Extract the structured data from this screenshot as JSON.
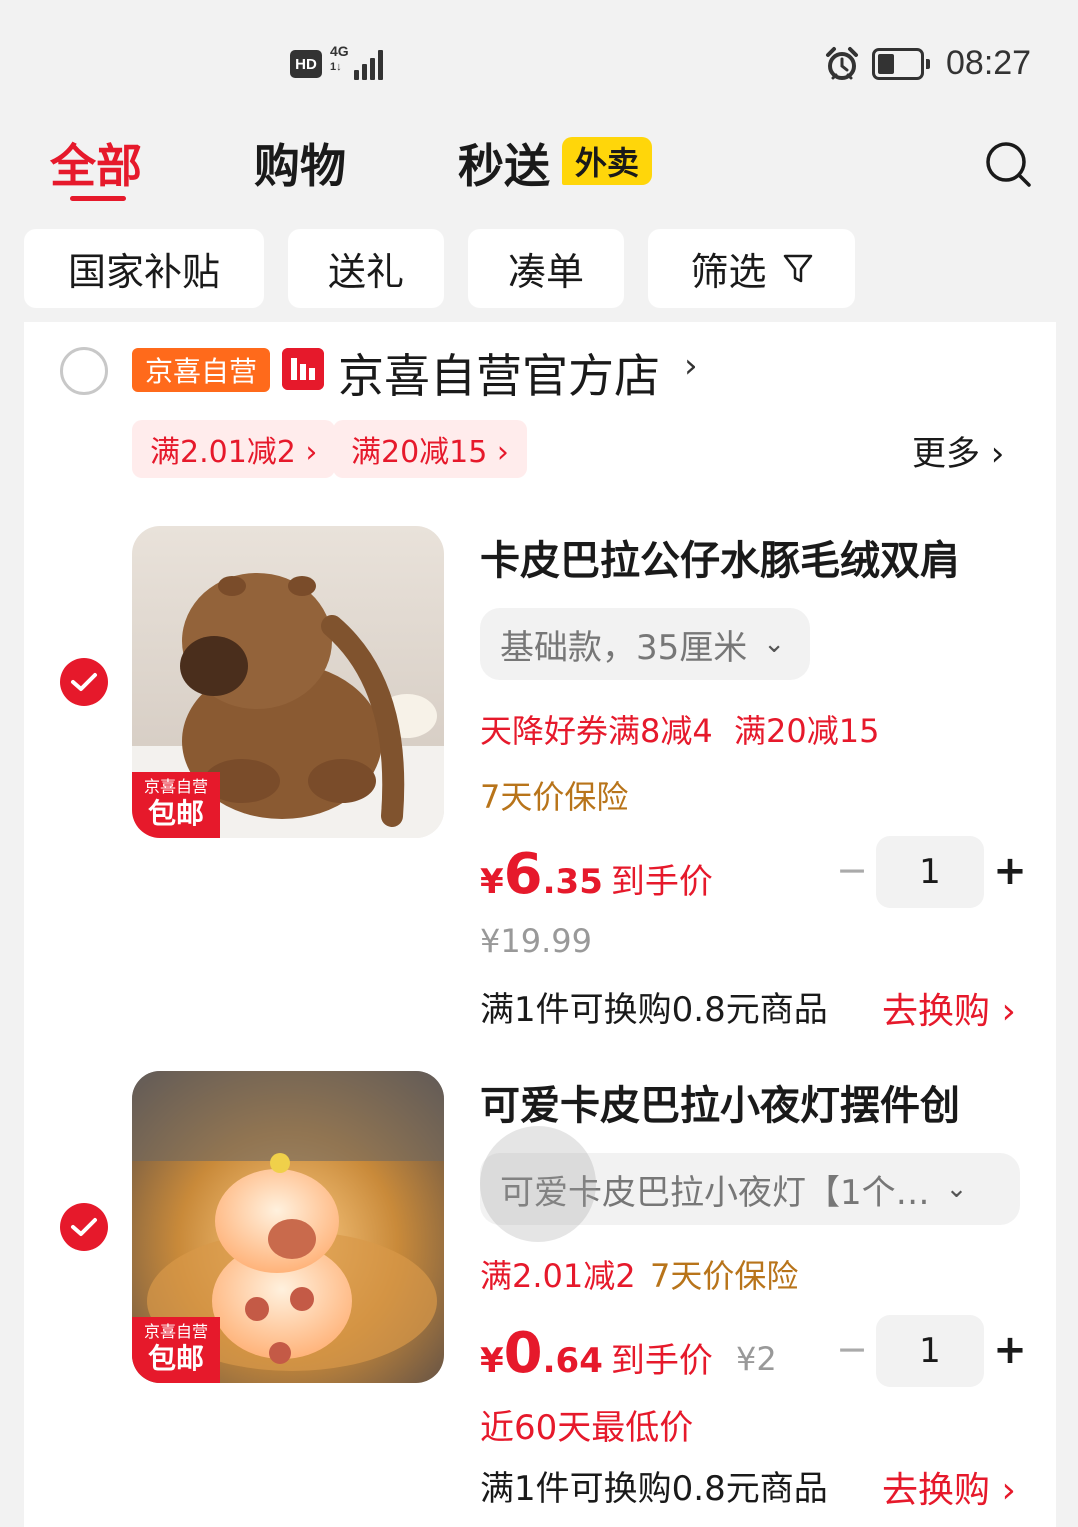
{
  "status_bar": {
    "hd": "HD",
    "network": "4G",
    "network_sub": "1↓",
    "time": "08:27",
    "battery_level": 0.4
  },
  "tabs": [
    {
      "label": "全部",
      "active": true
    },
    {
      "label": "购物",
      "active": false
    },
    {
      "label": "秒送",
      "active": false,
      "badge": "外卖"
    }
  ],
  "filters": [
    {
      "label": "国家补贴"
    },
    {
      "label": "送礼"
    },
    {
      "label": "凑单"
    },
    {
      "label": "筛选"
    }
  ],
  "store": {
    "tag": "京喜自营",
    "name": "京喜自营官方店",
    "arrow": "›",
    "promos": [
      "满2.01减2 ›",
      "满20减15 ›"
    ],
    "more": "更多 ›"
  },
  "items": [
    {
      "title": "卡皮巴拉公仔水豚毛绒双肩",
      "variant": "基础款，35厘米",
      "coupons": [
        "天降好券满8减4",
        "满20减15"
      ],
      "insurance": "7天价保险",
      "price_yen": "¥",
      "price_int": "6",
      "price_dec": ".35",
      "price_label": "到手价",
      "original_price": "¥19.99",
      "quantity": "1",
      "exchange_text": "满1件可换购0.8元商品",
      "exchange_link": "去换购 ›",
      "thumb_badge_top": "京喜自营",
      "thumb_badge_bottom": "包邮",
      "checked": true
    },
    {
      "title": "可爱卡皮巴拉小夜灯摆件创",
      "variant": "可爱卡皮巴拉小夜灯【1个…",
      "coupons": [
        "满2.01减2"
      ],
      "insurance": "7天价保险",
      "price_yen": "¥",
      "price_int": "0",
      "price_dec": ".64",
      "price_label": "到手价",
      "original_price": "¥2",
      "lowest_note": "近60天最低价",
      "quantity": "1",
      "exchange_text": "满1件可换购0.8元商品",
      "exchange_link": "去换购 ›",
      "thumb_badge_top": "京喜自营",
      "thumb_badge_bottom": "包邮",
      "checked": true
    }
  ],
  "qty_controls": {
    "minus": "−",
    "plus": "+"
  },
  "colors": {
    "accent": "#e6192b",
    "store_tag": "#ff6a1b",
    "badge_yellow": "#ffd60a",
    "gold": "#b8741a"
  }
}
